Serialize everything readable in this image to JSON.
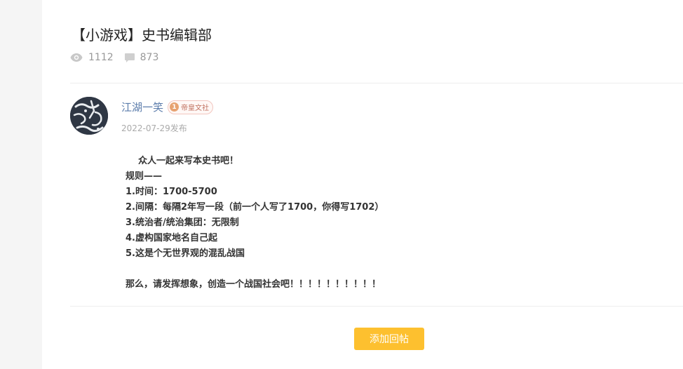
{
  "post": {
    "title": "【小游戏】史书编辑部",
    "views": "1112",
    "comments": "873"
  },
  "author": {
    "name": "江湖一笑",
    "badge_level": "1",
    "badge_text": "帝皇文社",
    "date": "2022-07-29发布"
  },
  "content": {
    "line1": "众人一起来写本史书吧！",
    "line2": "规则——",
    "line3": "1.时间：1700-5700",
    "line4": "2.间隔：每隔2年写一段（前一个人写了1700，你得写1702）",
    "line5": "3.统治者/统治集团：无限制",
    "line6": "4.虚构国家地名自己起",
    "line7": "5.这是个无世界观的混乱战国",
    "line8": "那么，请发挥想象，创造一个战国社会吧！！！！！！！！！！"
  },
  "actions": {
    "reply_label": "添加回帖"
  },
  "icons": {
    "views": "eye-icon",
    "comments": "comment-icon"
  },
  "colors": {
    "accent": "#fdc02f",
    "author_name": "#5b7cab"
  }
}
